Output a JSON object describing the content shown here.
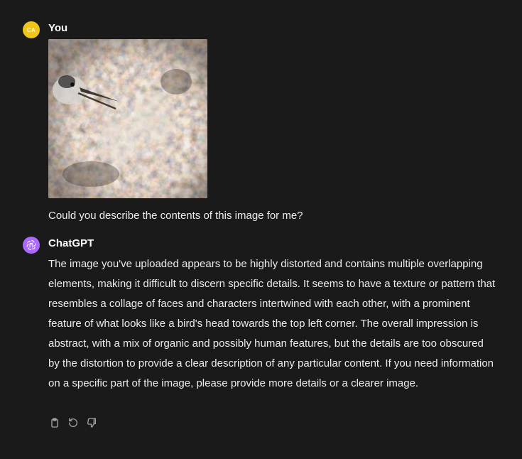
{
  "messages": {
    "user": {
      "avatar_initials": "CA",
      "author": "You",
      "image_alt": "uploaded distorted collage image",
      "text": "Could you describe the contents of this image for me?"
    },
    "assistant": {
      "avatar_icon": "openai-logo-icon",
      "author": "ChatGPT",
      "text": "The image you've uploaded appears to be highly distorted and contains multiple overlapping elements, making it difficult to discern specific details. It seems to have a texture or pattern that resembles a collage of faces and characters intertwined with each other, with a prominent feature of what looks like a bird's head towards the top left corner. The overall impression is abstract, with a mix of organic and possibly human features, but the details are too obscured by the distortion to provide a clear description of any particular content. If you need information on a specific part of the image, please provide more details or a clearer image."
    }
  },
  "actions": [
    {
      "icon": "clipboard-icon"
    },
    {
      "icon": "regenerate-icon"
    },
    {
      "icon": "thumbs-down-icon"
    }
  ],
  "colors": {
    "background": "#1a1a1a",
    "text": "#ececec",
    "user_avatar": "#f0c419",
    "assistant_avatar": "#ab68ff",
    "icon": "#a3a3a3"
  }
}
